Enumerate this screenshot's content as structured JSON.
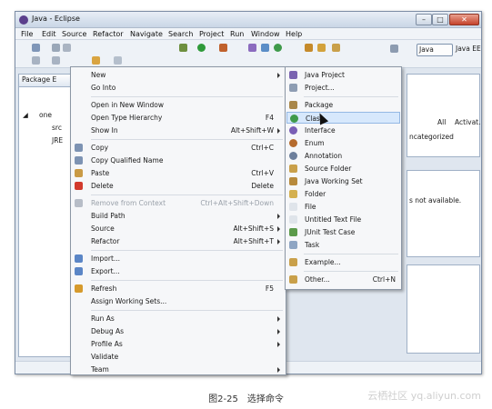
{
  "window": {
    "title": "Java - Eclipse",
    "buttons": {
      "min": "–",
      "max": "□",
      "close": "✕"
    }
  },
  "menubar": [
    "File",
    "Edit",
    "Source",
    "Refactor",
    "Navigate",
    "Search",
    "Project",
    "Run",
    "Window",
    "Help"
  ],
  "toolbar": {
    "perspectives": [
      {
        "label": "Java",
        "active": true
      },
      {
        "label": "Java EE",
        "active": false
      }
    ]
  },
  "left_view": {
    "tab_label": "Package E",
    "tree": [
      {
        "label": "one",
        "icon": "project-icon"
      },
      {
        "label": "src",
        "icon": "folder-icon"
      },
      {
        "label": "JRE",
        "icon": "library-icon"
      }
    ]
  },
  "right_views": {
    "top_links": [
      "All",
      "Activat..."
    ],
    "top_text": "ncategorized",
    "middle_text": "s not available."
  },
  "context_menu": {
    "items": [
      {
        "label": "New",
        "shortcut": "",
        "submenu": true,
        "icon": "",
        "disabled": false
      },
      {
        "label": "Go Into",
        "shortcut": "",
        "submenu": false,
        "icon": "",
        "disabled": false
      },
      {
        "separator": true
      },
      {
        "label": "Open in New Window",
        "shortcut": "",
        "submenu": false,
        "icon": "",
        "disabled": false
      },
      {
        "label": "Open Type Hierarchy",
        "shortcut": "F4",
        "submenu": false,
        "icon": "",
        "disabled": false
      },
      {
        "label": "Show In",
        "shortcut": "Alt+Shift+W",
        "submenu": true,
        "icon": "",
        "disabled": false
      },
      {
        "separator": true
      },
      {
        "label": "Copy",
        "shortcut": "Ctrl+C",
        "submenu": false,
        "icon": "copy-icon",
        "disabled": false
      },
      {
        "label": "Copy Qualified Name",
        "shortcut": "",
        "submenu": false,
        "icon": "copy-icon",
        "disabled": false
      },
      {
        "label": "Paste",
        "shortcut": "Ctrl+V",
        "submenu": false,
        "icon": "paste-icon",
        "disabled": false
      },
      {
        "label": "Delete",
        "shortcut": "Delete",
        "submenu": false,
        "icon": "delete-icon",
        "disabled": false
      },
      {
        "separator": true
      },
      {
        "label": "Remove from Context",
        "shortcut": "Ctrl+Alt+Shift+Down",
        "submenu": false,
        "icon": "remove-icon",
        "disabled": true
      },
      {
        "label": "Build Path",
        "shortcut": "",
        "submenu": true,
        "icon": "",
        "disabled": false
      },
      {
        "label": "Source",
        "shortcut": "Alt+Shift+S",
        "submenu": true,
        "icon": "",
        "disabled": false
      },
      {
        "label": "Refactor",
        "shortcut": "Alt+Shift+T",
        "submenu": true,
        "icon": "",
        "disabled": false
      },
      {
        "separator": true
      },
      {
        "label": "Import...",
        "shortcut": "",
        "submenu": false,
        "icon": "import-icon",
        "disabled": false
      },
      {
        "label": "Export...",
        "shortcut": "",
        "submenu": false,
        "icon": "export-icon",
        "disabled": false
      },
      {
        "separator": true
      },
      {
        "label": "Refresh",
        "shortcut": "F5",
        "submenu": false,
        "icon": "refresh-icon",
        "disabled": false
      },
      {
        "label": "Assign Working Sets...",
        "shortcut": "",
        "submenu": false,
        "icon": "",
        "disabled": false
      },
      {
        "separator": true
      },
      {
        "label": "Run As",
        "shortcut": "",
        "submenu": true,
        "icon": "",
        "disabled": false
      },
      {
        "label": "Debug As",
        "shortcut": "",
        "submenu": true,
        "icon": "",
        "disabled": false
      },
      {
        "label": "Profile As",
        "shortcut": "",
        "submenu": true,
        "icon": "",
        "disabled": false
      },
      {
        "label": "Validate",
        "shortcut": "",
        "submenu": false,
        "icon": "",
        "disabled": false
      },
      {
        "label": "Team",
        "shortcut": "",
        "submenu": true,
        "icon": "",
        "disabled": false
      }
    ]
  },
  "new_submenu": {
    "items": [
      {
        "label": "Java Project",
        "icon": "java-project-icon",
        "shortcut": "",
        "selected": false
      },
      {
        "label": "Project...",
        "icon": "project-icon",
        "shortcut": "",
        "selected": false
      },
      {
        "separator": true
      },
      {
        "label": "Package",
        "icon": "package-icon",
        "shortcut": "",
        "selected": false
      },
      {
        "label": "Class",
        "icon": "class-icon",
        "shortcut": "",
        "selected": true
      },
      {
        "label": "Interface",
        "icon": "interface-icon",
        "shortcut": "",
        "selected": false
      },
      {
        "label": "Enum",
        "icon": "enum-icon",
        "shortcut": "",
        "selected": false
      },
      {
        "label": "Annotation",
        "icon": "annotation-icon",
        "shortcut": "",
        "selected": false
      },
      {
        "label": "Source Folder",
        "icon": "source-folder-icon",
        "shortcut": "",
        "selected": false
      },
      {
        "label": "Java Working Set",
        "icon": "working-set-icon",
        "shortcut": "",
        "selected": false
      },
      {
        "label": "Folder",
        "icon": "folder-icon",
        "shortcut": "",
        "selected": false
      },
      {
        "label": "File",
        "icon": "file-icon",
        "shortcut": "",
        "selected": false
      },
      {
        "label": "Untitled Text File",
        "icon": "text-file-icon",
        "shortcut": "",
        "selected": false
      },
      {
        "label": "JUnit Test Case",
        "icon": "junit-icon",
        "shortcut": "",
        "selected": false
      },
      {
        "label": "Task",
        "icon": "task-icon",
        "shortcut": "",
        "selected": false
      },
      {
        "separator": true
      },
      {
        "label": "Example...",
        "icon": "example-icon",
        "shortcut": "",
        "selected": false
      },
      {
        "separator": true
      },
      {
        "label": "Other...",
        "icon": "other-icon",
        "shortcut": "Ctrl+N",
        "selected": false
      }
    ]
  },
  "caption": "图2-25　选择命令",
  "watermark": "云栖社区 yq.aliyun.com",
  "colors": {
    "selection": "#cfe3fb",
    "menu_bg": "#f6f7f9",
    "window_frame": "#7d8ea6"
  }
}
